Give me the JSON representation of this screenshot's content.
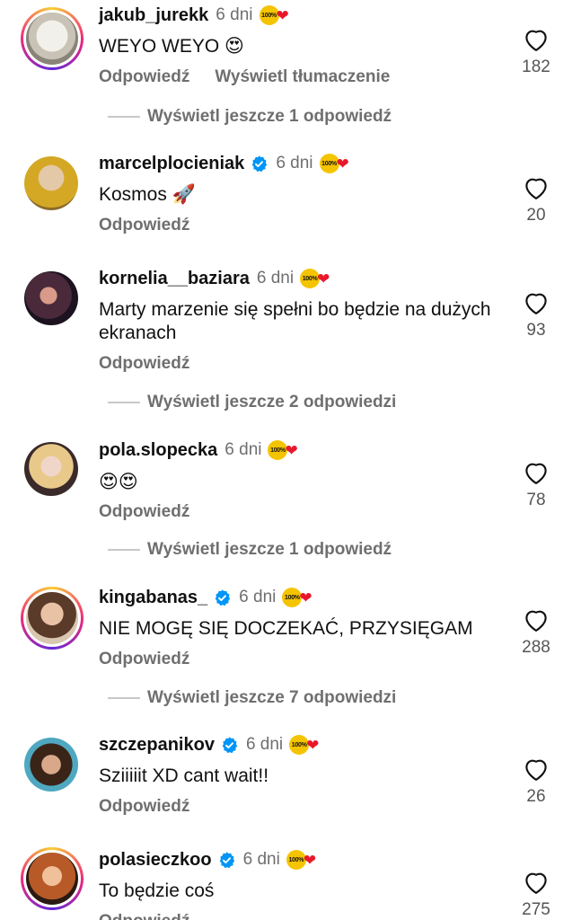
{
  "comments": [
    {
      "username": "jakub_jurekk",
      "time": "6 dni",
      "text": "WEYO WEYO 😍",
      "reply": "Odpowiedź",
      "translate": "Wyświetl tłumaczenie",
      "likes": "182",
      "verified": false
    },
    {
      "username": "marcelplocieniak",
      "time": "6 dni",
      "text": "Kosmos 🚀",
      "reply": "Odpowiedź",
      "likes": "20",
      "verified": true
    },
    {
      "username": "kornelia__baziara",
      "time": "6 dni",
      "text": "Marty marzenie się spełni bo będzie na dużych ekranach",
      "reply": "Odpowiedź",
      "likes": "93",
      "verified": false
    },
    {
      "username": "pola.slopecka",
      "time": "6 dni",
      "text": "😍😍",
      "reply": "Odpowiedź",
      "likes": "78",
      "verified": false
    },
    {
      "username": "kingabanas_",
      "time": "6 dni",
      "text": "NIE MOGĘ SIĘ DOCZEKAĆ, PRZYSIĘGAM",
      "reply": "Odpowiedź",
      "likes": "288",
      "verified": true
    },
    {
      "username": "szczepanikov",
      "time": "6 dni",
      "text": "Sziiiiit XD cant wait!!",
      "reply": "Odpowiedź",
      "likes": "26",
      "verified": true
    },
    {
      "username": "polasieczkoo",
      "time": "6 dni",
      "text": "To będzie coś",
      "reply": "Odpowiedź",
      "likes": "275",
      "verified": true
    }
  ],
  "more_replies": [
    "Wyświetl jeszcze 1 odpowiedź",
    "Wyświetl jeszcze 2 odpowiedzi",
    "Wyświetl jeszcze 1 odpowiedź",
    "Wyświetl jeszcze 7 odpowiedzi"
  ],
  "badge": {
    "text": "100%",
    "heart": "❤"
  },
  "colors": {
    "verified": "#0095f6",
    "badge": "#f5c400",
    "heart": "#e8182c",
    "muted": "#6f6f6f"
  },
  "icons": {
    "like": "heart-outline-icon",
    "verified": "verified-check-icon"
  }
}
